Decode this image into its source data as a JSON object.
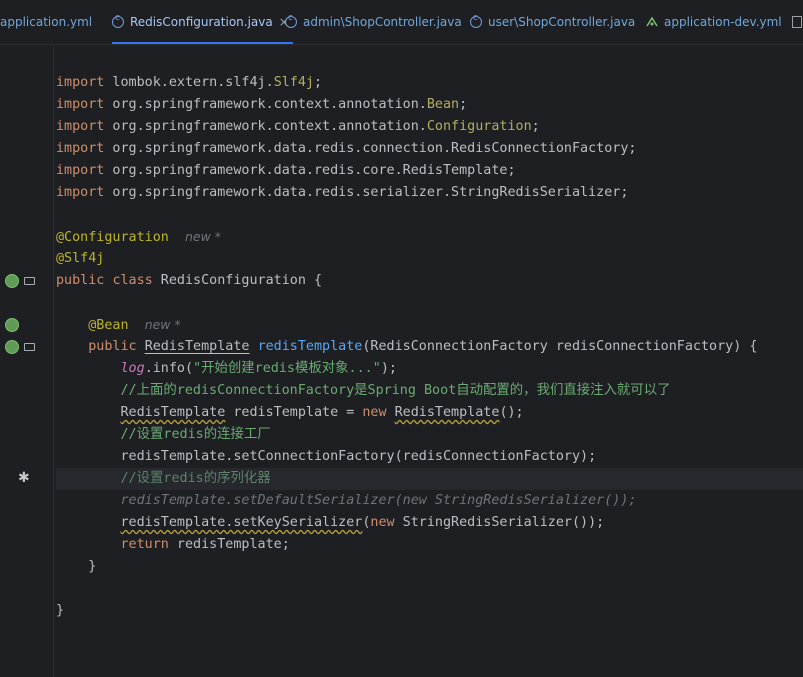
{
  "tabs": [
    {
      "label": "application.yml",
      "icon": "yaml-icon",
      "active": false
    },
    {
      "label": "RedisConfiguration.java",
      "icon": "class-icon",
      "active": true,
      "close": "×"
    },
    {
      "label": "admin\\ShopController.java",
      "icon": "class-icon",
      "active": false
    },
    {
      "label": "user\\ShopController.java",
      "icon": "class-icon",
      "active": false
    },
    {
      "label": "application-dev.yml",
      "icon": "yaml-icon",
      "active": false
    }
  ],
  "code": {
    "imports": [
      {
        "kw": "import",
        "path": " lombok.extern.slf4j.",
        "name": "Slf4j",
        "end": ";"
      },
      {
        "kw": "import",
        "path": " org.springframework.context.annotation.",
        "name": "Bean",
        "end": ";"
      },
      {
        "kw": "import",
        "path": " org.springframework.context.annotation.",
        "name": "Configuration",
        "end": ";"
      },
      {
        "kw": "import",
        "path": " org.springframework.data.redis.connection.RedisConnectionFactory",
        "name": "",
        "end": ";"
      },
      {
        "kw": "import",
        "path": " org.springframework.data.redis.core.RedisTemplate",
        "name": "",
        "end": ";"
      },
      {
        "kw": "import",
        "path": " org.springframework.data.redis.serializer.StringRedisSerializer",
        "name": "",
        "end": ";"
      }
    ],
    "annotation_config": "@Configuration",
    "annotation_slf4j": "@Slf4j",
    "hint_new": "new *",
    "class_decl_kw1": "public",
    "class_decl_kw2": "class",
    "class_name": " RedisConfiguration {",
    "annotation_bean": "@Bean",
    "method_kw": "public",
    "method_type": "RedisTemplate",
    "method_name": "redisTemplate",
    "method_params": "(RedisConnectionFactory redisConnectionFactory) {",
    "log_obj": "log",
    "log_call": ".info(",
    "log_str": "\"开始创建redis模板对象...\"",
    "log_end": ");",
    "comment1": "//上面的redisConnectionFactory是Spring Boot自动配置的，我们直接注入就可以了",
    "decl_type": "RedisTemplate",
    "decl_mid": " redisTemplate = ",
    "decl_new": "new",
    "decl_ctor": "RedisTemplate",
    "decl_end": "();",
    "comment2": "//设置redis的连接工厂",
    "set_factory": "redisTemplate.setConnectionFactory(redisConnectionFactory);",
    "comment3": "//设置redis的序列化器",
    "disabled_line": "redisTemplate.setDefaultSerializer(new StringRedisSerializer());",
    "key_ser_call": "redisTemplate.setKeySerializer",
    "key_ser_open": "(",
    "key_ser_new": "new",
    "key_ser_end": " StringRedisSerializer());",
    "return_kw": "return",
    "return_val": " redisTemplate;",
    "close_method": "}",
    "close_class": "}"
  }
}
